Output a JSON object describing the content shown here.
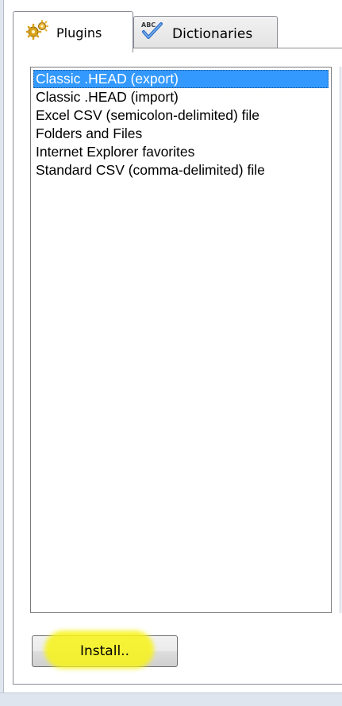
{
  "tabs": [
    {
      "label": "Plugins",
      "icon": "puzzle-gears-icon",
      "selected": true
    },
    {
      "label": "Dictionaries",
      "icon": "abc-checkmark-icon",
      "selected": false
    }
  ],
  "plugins": {
    "items": [
      {
        "label": "Classic .HEAD (export)",
        "selected": true
      },
      {
        "label": "Classic .HEAD (import)",
        "selected": false
      },
      {
        "label": "Excel CSV (semicolon-delimited) file",
        "selected": false
      },
      {
        "label": "Folders and Files",
        "selected": false
      },
      {
        "label": "Internet Explorer favorites",
        "selected": false
      },
      {
        "label": "Standard CSV (comma-delimited) file",
        "selected": false
      }
    ]
  },
  "buttons": {
    "install_label": "Install.."
  },
  "colors": {
    "selection": "#3399ff",
    "highlight": "#f7f31c",
    "border": "#898c95"
  }
}
